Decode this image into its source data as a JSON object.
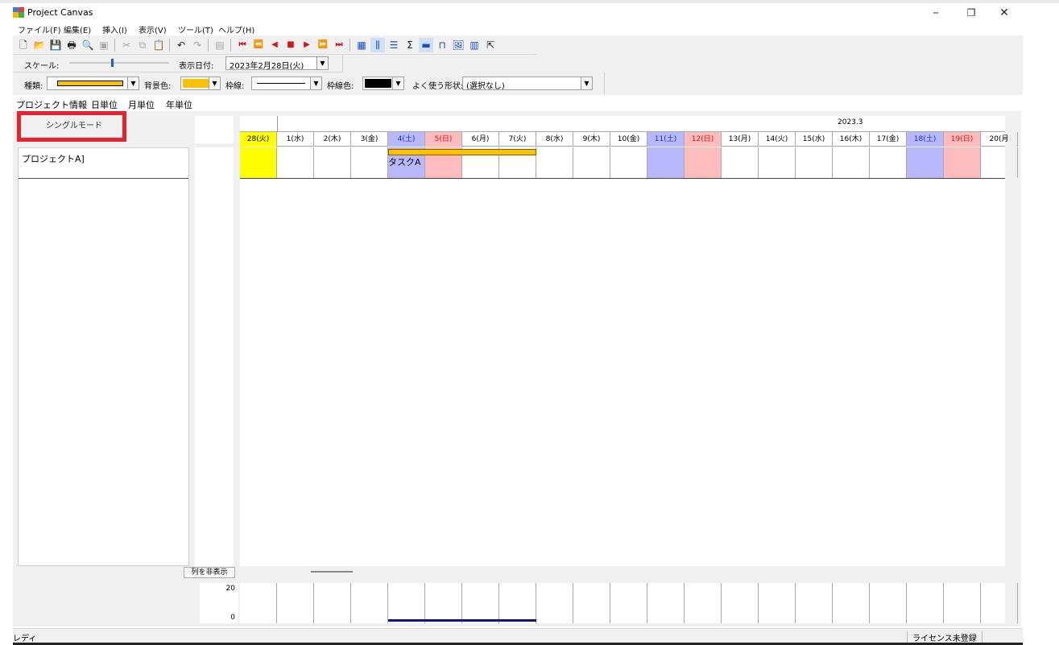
{
  "window": {
    "title": "Project Canvas",
    "minimize_glyph": "–",
    "restore_glyph": "❐",
    "close_glyph": "✕"
  },
  "menu": [
    "ファイル(F)",
    "編集(E)",
    "挿入(I)",
    "表示(V)",
    "ツール(T)",
    "ヘルプ(H)"
  ],
  "toolbar2": {
    "scale_label": "スケール:",
    "display_date_label": "表示日付:",
    "display_date_value": "2023年2月28日(火)"
  },
  "toolbar3": {
    "type_label": "種類:",
    "bg_color_label": "背景色:",
    "border_label": "枠線:",
    "border_color_label": "枠線色:",
    "frequent_shape_label": "よく使う形状:",
    "frequent_shape_value": "(選択なし)",
    "type_color": "#ffc000",
    "bg_color": "#ffc000",
    "border_color": "#000000"
  },
  "tabs": [
    "プロジェクト情報",
    "日単位",
    "月単位",
    "年単位"
  ],
  "mode_button": "シングルモード",
  "project_row": "プロジェクトA]",
  "hide_columns_button": "列を非表示",
  "timeline": {
    "month_label": "2023.3",
    "days": [
      {
        "label": "28(火)",
        "kind": "today"
      },
      {
        "label": "1(水)",
        "kind": "weekday"
      },
      {
        "label": "2(木)",
        "kind": "weekday"
      },
      {
        "label": "3(金)",
        "kind": "weekday"
      },
      {
        "label": "4(土)",
        "kind": "sat"
      },
      {
        "label": "5(日)",
        "kind": "sun"
      },
      {
        "label": "6(月)",
        "kind": "weekday"
      },
      {
        "label": "7(火)",
        "kind": "weekday"
      },
      {
        "label": "8(水)",
        "kind": "weekday"
      },
      {
        "label": "9(木)",
        "kind": "weekday"
      },
      {
        "label": "10(金)",
        "kind": "weekday"
      },
      {
        "label": "11(土)",
        "kind": "sat"
      },
      {
        "label": "12(日)",
        "kind": "sun"
      },
      {
        "label": "13(月)",
        "kind": "weekday"
      },
      {
        "label": "14(火)",
        "kind": "weekday"
      },
      {
        "label": "15(水)",
        "kind": "weekday"
      },
      {
        "label": "16(木)",
        "kind": "weekday"
      },
      {
        "label": "17(金)",
        "kind": "weekday"
      },
      {
        "label": "18(土)",
        "kind": "sat"
      },
      {
        "label": "19(日)",
        "kind": "sun"
      },
      {
        "label": "20(月",
        "kind": "weekday"
      }
    ]
  },
  "task": {
    "name": "タスクA",
    "bar_color": "#ffc000"
  },
  "load_chart": {
    "max_label": "20",
    "min_label": "0",
    "line_color": "#14147a"
  },
  "status": {
    "left": "レディ",
    "right": "ライセンス未登録"
  }
}
